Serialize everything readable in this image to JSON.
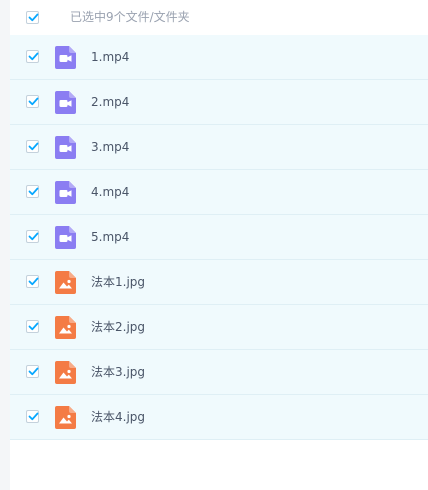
{
  "header": {
    "selection_text": "已选中9个文件/文件夹",
    "checked": true
  },
  "files": [
    {
      "name": "1.mp4",
      "type": "video",
      "checked": true
    },
    {
      "name": "2.mp4",
      "type": "video",
      "checked": true
    },
    {
      "name": "3.mp4",
      "type": "video",
      "checked": true
    },
    {
      "name": "4.mp4",
      "type": "video",
      "checked": true
    },
    {
      "name": "5.mp4",
      "type": "video",
      "checked": true
    },
    {
      "name": "法本1.jpg",
      "type": "image",
      "checked": true
    },
    {
      "name": "法本2.jpg",
      "type": "image",
      "checked": true
    },
    {
      "name": "法本3.jpg",
      "type": "image",
      "checked": true
    },
    {
      "name": "法本4.jpg",
      "type": "image",
      "checked": true
    }
  ],
  "colors": {
    "check": "#06a7ff",
    "video_icon": "#8b7df2",
    "image_icon": "#f47b45",
    "row_bg": "#f0fafd"
  },
  "icons": {
    "video": "video-file-icon",
    "image": "image-file-icon",
    "checkbox": "checkmark-icon"
  }
}
